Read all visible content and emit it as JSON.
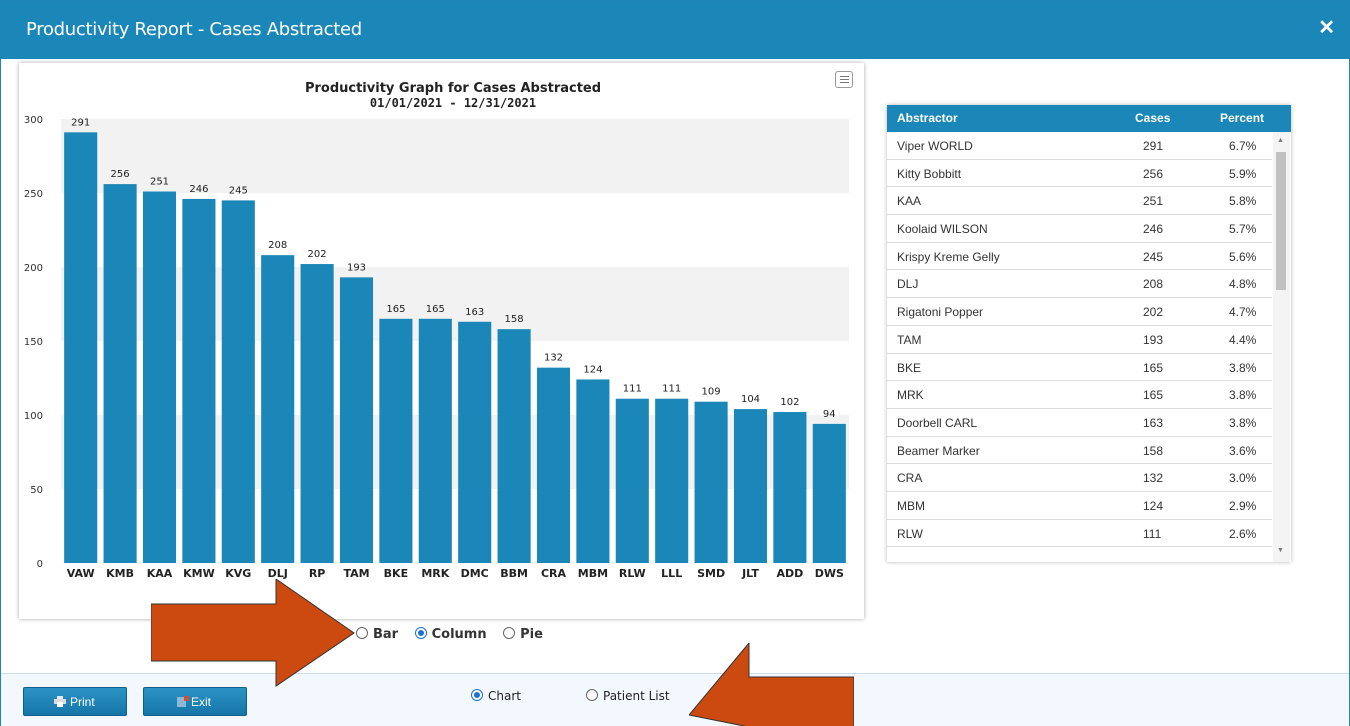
{
  "window": {
    "title": "Productivity Report - Cases Abstracted",
    "close_icon": "✕"
  },
  "chart_data": {
    "type": "bar",
    "title": "Productivity Graph for Cases Abstracted",
    "subtitle": "01/01/2021 - 12/31/2021",
    "categories": [
      "VAW",
      "KMB",
      "KAA",
      "KMW",
      "KVG",
      "DLJ",
      "RP",
      "TAM",
      "BKE",
      "MRK",
      "DMC",
      "BBM",
      "CRA",
      "MBM",
      "RLW",
      "LLL",
      "SMD",
      "JLT",
      "ADD",
      "DWS"
    ],
    "values": [
      291,
      256,
      251,
      246,
      245,
      208,
      202,
      193,
      165,
      165,
      163,
      158,
      132,
      124,
      111,
      111,
      109,
      104,
      102,
      94
    ],
    "yticks": [
      0,
      50,
      100,
      150,
      200,
      250,
      300
    ],
    "ylim": [
      0,
      300
    ],
    "bar_color": "#1b87b8",
    "band_color": "#f2f2f2",
    "xlabel": "",
    "ylabel": ""
  },
  "chart_type": {
    "options": [
      {
        "label": "Bar",
        "selected": false
      },
      {
        "label": "Column",
        "selected": true
      },
      {
        "label": "Pie",
        "selected": false
      }
    ]
  },
  "table": {
    "headers": {
      "abstractor": "Abstractor",
      "cases": "Cases",
      "percent": "Percent"
    },
    "rows": [
      {
        "name": "Viper WORLD",
        "cases": "291",
        "percent": "6.7%"
      },
      {
        "name": "Kitty Bobbitt",
        "cases": "256",
        "percent": "5.9%"
      },
      {
        "name": "KAA",
        "cases": "251",
        "percent": "5.8%"
      },
      {
        "name": "Koolaid WILSON",
        "cases": "246",
        "percent": "5.7%"
      },
      {
        "name": "Krispy Kreme Gelly",
        "cases": "245",
        "percent": "5.6%"
      },
      {
        "name": "DLJ",
        "cases": "208",
        "percent": "4.8%"
      },
      {
        "name": "Rigatoni Popper",
        "cases": "202",
        "percent": "4.7%"
      },
      {
        "name": "TAM",
        "cases": "193",
        "percent": "4.4%"
      },
      {
        "name": "BKE",
        "cases": "165",
        "percent": "3.8%"
      },
      {
        "name": "MRK",
        "cases": "165",
        "percent": "3.8%"
      },
      {
        "name": "Doorbell CARL",
        "cases": "163",
        "percent": "3.8%"
      },
      {
        "name": "Beamer Marker",
        "cases": "158",
        "percent": "3.6%"
      },
      {
        "name": "CRA",
        "cases": "132",
        "percent": "3.0%"
      },
      {
        "name": "MBM",
        "cases": "124",
        "percent": "2.9%"
      },
      {
        "name": "RLW",
        "cases": "111",
        "percent": "2.6%"
      }
    ]
  },
  "footer": {
    "print_label": "Print",
    "exit_label": "Exit",
    "view_options": [
      {
        "label": "Chart",
        "selected": true
      },
      {
        "label": "Patient List",
        "selected": false
      }
    ]
  },
  "colors": {
    "header_blue": "#1b87b8",
    "annotation_arrow": "#cc4a10"
  }
}
